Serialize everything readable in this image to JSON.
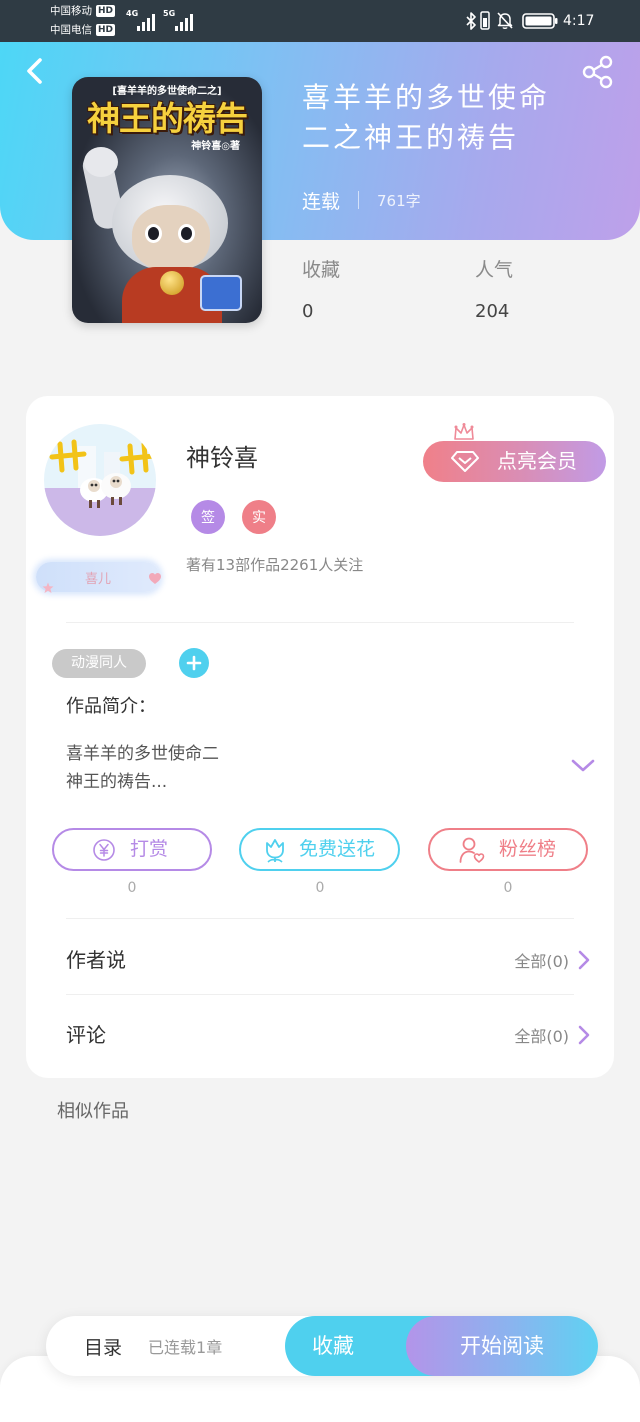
{
  "colors": {
    "header_start": "#4dd7f6",
    "header_end": "#bea0ea",
    "accent_purple": "#b58ae6",
    "accent_pink": "#ef7f88",
    "accent_cyan": "#4fd0ee",
    "tag_gray": "#c9c9c9",
    "status_bar": "#2f3b44"
  },
  "status_bar": {
    "carriers": [
      {
        "name": "中国移动",
        "badge": "HD",
        "network": "4G"
      },
      {
        "name": "中国电信",
        "badge": "HD",
        "network": "5G"
      }
    ],
    "icons": [
      "bluetooth-icon",
      "vibrate-icon",
      "bell-off-icon",
      "battery-icon"
    ],
    "time": "4:17"
  },
  "header": {
    "back_icon": "back-arrow-icon",
    "share_icon": "share-icon",
    "title_lines": [
      "喜羊羊的多世使命",
      "二之神王的祷告"
    ],
    "status": "连载",
    "word_count": "761字"
  },
  "cover": {
    "series_label": "[喜羊羊的多世使命二之]",
    "title": "神王的祷告",
    "author_line": "神铃喜◎著"
  },
  "stats": [
    {
      "label": "收藏",
      "value": "0"
    },
    {
      "label": "人气",
      "value": "204"
    }
  ],
  "author": {
    "name": "神铃喜",
    "fan_badge": "喜儿",
    "badges": [
      {
        "text": "签",
        "color": "#b58ae6"
      },
      {
        "text": "实",
        "color": "#ef7f88"
      }
    ],
    "summary": "著有13部作品2261人关注",
    "vip_button": "点亮会员",
    "vip_icon": "diamond-icon"
  },
  "tags": [
    "动漫同人"
  ],
  "intro": {
    "label": "作品简介：",
    "text_lines": [
      "喜羊羊的多世使命二",
      "神王的祷告..."
    ],
    "expand_icon": "chevron-down-icon"
  },
  "actions": [
    {
      "label": "打赏",
      "count": "0",
      "icon": "yen-icon"
    },
    {
      "label": "免费送花",
      "count": "0",
      "icon": "flower-icon"
    },
    {
      "label": "粉丝榜",
      "count": "0",
      "icon": "fan-rank-icon"
    }
  ],
  "sections": [
    {
      "title": "作者说",
      "link": "全部(0)"
    },
    {
      "title": "评论",
      "link": "全部(0)"
    }
  ],
  "similar_title": "相似作品",
  "bottom_bar": {
    "catalog": "目录",
    "chapters": "已连载1章",
    "collect": "收藏",
    "read": "开始阅读"
  }
}
